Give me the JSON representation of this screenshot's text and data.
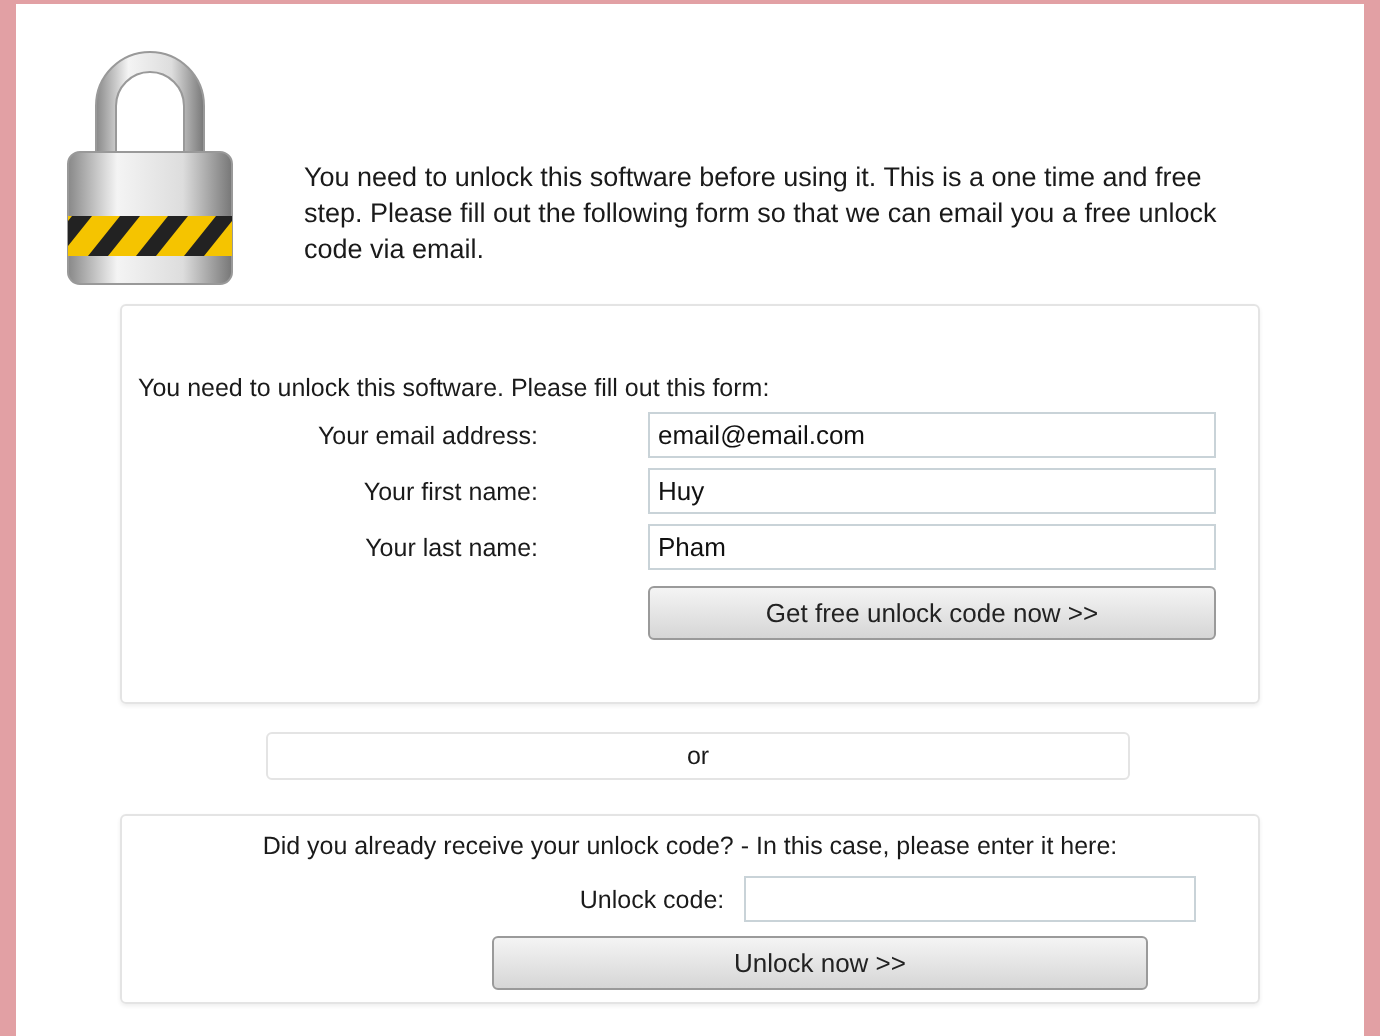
{
  "intro": "You need to unlock this software before using it. This is a one time and free step. Please fill out the following form so that we can email you a free unlock code via email.",
  "request_form": {
    "prompt": "You need to unlock this software. Please fill out this form:",
    "fields": [
      {
        "label": "Your email address:",
        "value": "email@email.com"
      },
      {
        "label": "Your first name:",
        "value": "Huy"
      },
      {
        "label": "Your last name:",
        "value": "Pham"
      }
    ],
    "button": "Get free unlock code now >>"
  },
  "separator": "or",
  "unlock_form": {
    "prompt": "Did you already receive your unlock code? - In this case, please enter it here:",
    "field": {
      "label": "Unlock code:"
    },
    "button": "Unlock now >>"
  }
}
